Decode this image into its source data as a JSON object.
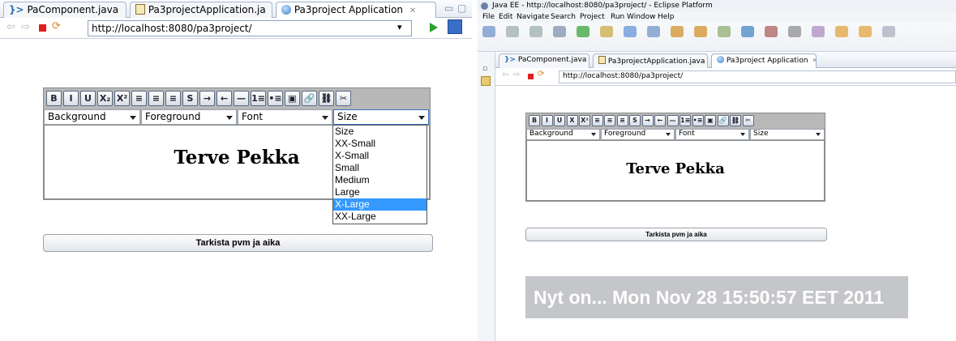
{
  "left": {
    "tabs": [
      {
        "label": "PaComponent.java",
        "icon": "java-class-icon"
      },
      {
        "label": "Pa3projectApplication.ja",
        "icon": "java-file-icon"
      },
      {
        "label": "Pa3project Application",
        "icon": "globe-icon",
        "close": "✕",
        "active": true
      }
    ],
    "window_controls": {
      "minimize": "▭",
      "maximize": "▢"
    },
    "url": "http://localhost:8080/pa3project/",
    "url_dropdown": "▾",
    "editor": {
      "toolbar_labels": [
        "B",
        "I",
        "U",
        "X₂",
        "X²",
        "≡",
        "≡",
        "≡",
        "S",
        "→",
        "←",
        "—",
        "1≡",
        "•≡",
        "▣",
        "🔗",
        "⛓",
        "✂"
      ],
      "background_select": "Background",
      "foreground_select": "Foreground",
      "font_select": "Font",
      "size_select": "Size",
      "content_text": "Terve Pekka",
      "size_options": [
        "Size",
        "XX-Small",
        "X-Small",
        "Small",
        "Medium",
        "Large",
        "X-Large",
        "XX-Large"
      ],
      "size_selected": "X-Large"
    },
    "check_button": "Tarkista pvm ja aika"
  },
  "right": {
    "window_title": "Java EE - http://localhost:8080/pa3project/ - Eclipse Platform",
    "menu": [
      "File",
      "Edit",
      "Navigate",
      "Search",
      "Project",
      "Run",
      "Window",
      "Help"
    ],
    "tabs": [
      {
        "label": "PaComponent.java"
      },
      {
        "label": "Pa3projectApplication.java"
      },
      {
        "label": "Pa3project Application",
        "close": "✕",
        "active": true
      }
    ],
    "url": "http://localhost:8080/pa3project/",
    "editor": {
      "toolbar_labels": [
        "B",
        "I",
        "U",
        "X",
        "X²",
        "≡",
        "≡",
        "≡",
        "S",
        "→",
        "←",
        "—",
        "1≡",
        "•≡",
        "▣",
        "🔗",
        "⛓",
        "✂"
      ],
      "background_select": "Background",
      "foreground_select": "Foreground",
      "font_select": "Font",
      "size_select": "Size",
      "content_text": "Terve Pekka"
    },
    "check_button": "Tarkista pvm ja aika",
    "result_label": "Nyt on... Mon Nov 28 15:50:57 EET 2011"
  },
  "colors": {
    "selection": "#3399ff",
    "editor_frame": "#a8a8a8",
    "result_bg": "#c4c6c9",
    "result_text": "#ffffff",
    "run_green": "#2ca02c",
    "stop_red": "#e02020"
  }
}
